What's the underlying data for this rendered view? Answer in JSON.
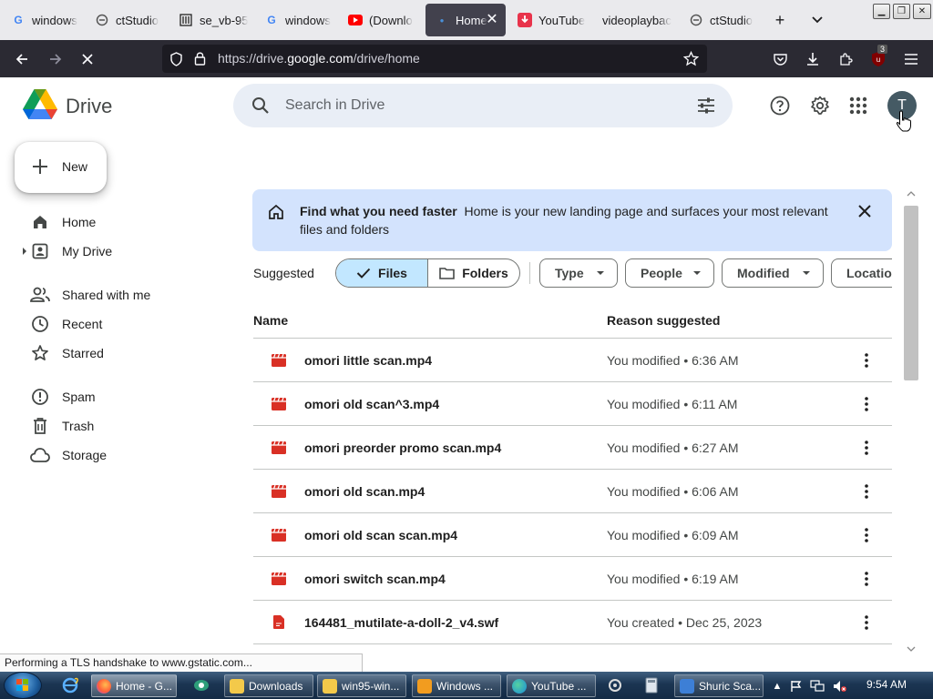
{
  "browser": {
    "tabs": [
      {
        "label": "windows",
        "icon": "google-icon"
      },
      {
        "label": "ctStudio",
        "icon": "ctstudio-icon"
      },
      {
        "label": "se_vb-95",
        "icon": "archive-icon"
      },
      {
        "label": "windows",
        "icon": "google-icon"
      },
      {
        "label": "(Downlo",
        "icon": "youtube-icon"
      },
      {
        "label": "Home",
        "icon": "drive-icon",
        "active": true
      },
      {
        "label": "YouTube",
        "icon": "youtube-downloader-icon"
      },
      {
        "label": "videoplaybac",
        "icon": "none"
      },
      {
        "label": "ctStudio",
        "icon": "ctstudio-icon"
      }
    ],
    "url": {
      "prefix": "https://drive.",
      "domain": "google.com",
      "path": "/drive/home"
    },
    "extension_badge": "3"
  },
  "drive": {
    "title": "Drive",
    "search_placeholder": "Search in Drive",
    "avatar_letter": "T",
    "new_label": "New",
    "sidebar": [
      {
        "label": "Home",
        "icon": "home-icon"
      },
      {
        "label": "My Drive",
        "icon": "my-drive-icon"
      },
      {
        "label": "Shared with me",
        "icon": "shared-icon"
      },
      {
        "label": "Recent",
        "icon": "clock-icon"
      },
      {
        "label": "Starred",
        "icon": "star-icon"
      },
      {
        "label": "Spam",
        "icon": "spam-icon"
      },
      {
        "label": "Trash",
        "icon": "trash-icon"
      },
      {
        "label": "Storage",
        "icon": "cloud-icon"
      }
    ],
    "banner": {
      "title": "Find what you need faster",
      "text": "Home is your new landing page and surfaces your most relevant files and folders"
    },
    "suggested_label": "Suggested",
    "toggle": {
      "files": "Files",
      "folders": "Folders",
      "selected": "Files"
    },
    "filters": [
      "Type",
      "People",
      "Modified",
      "Location"
    ],
    "columns": {
      "name": "Name",
      "reason": "Reason suggested"
    },
    "files": [
      {
        "name": "omori little scan.mp4",
        "reason": "You modified • 6:36 AM",
        "type": "video"
      },
      {
        "name": "omori old scan^3.mp4",
        "reason": "You modified • 6:11 AM",
        "type": "video"
      },
      {
        "name": "omori preorder promo scan.mp4",
        "reason": "You modified • 6:27 AM",
        "type": "video"
      },
      {
        "name": "omori old scan.mp4",
        "reason": "You modified • 6:06 AM",
        "type": "video"
      },
      {
        "name": "omori old scan scan.mp4",
        "reason": "You modified • 6:09 AM",
        "type": "video"
      },
      {
        "name": "omori switch scan.mp4",
        "reason": "You modified • 6:19 AM",
        "type": "video"
      },
      {
        "name": "164481_mutilate-a-doll-2_v4.swf",
        "reason": "You created • Dec 25, 2023",
        "type": "file"
      }
    ]
  },
  "status_text": "Performing a TLS handshake to www.gstatic.com...",
  "taskbar": {
    "items": [
      {
        "label": "Home - G...",
        "icon": "firefox-icon",
        "active": true
      },
      {
        "label": "Downloads",
        "icon": "folder-icon"
      },
      {
        "label": "win95-win...",
        "icon": "folder-icon"
      },
      {
        "label": "Windows ...",
        "icon": "media-icon"
      },
      {
        "label": "YouTube ...",
        "icon": "edge-icon"
      },
      {
        "label": "Shuric Sca...",
        "icon": "app-icon"
      }
    ],
    "clock": "9:54 AM"
  },
  "colors": {
    "accent": "#0b57d0",
    "file_red": "#d93025",
    "banner": "#d3e3fd",
    "selected_chip": "#c2e7ff"
  }
}
